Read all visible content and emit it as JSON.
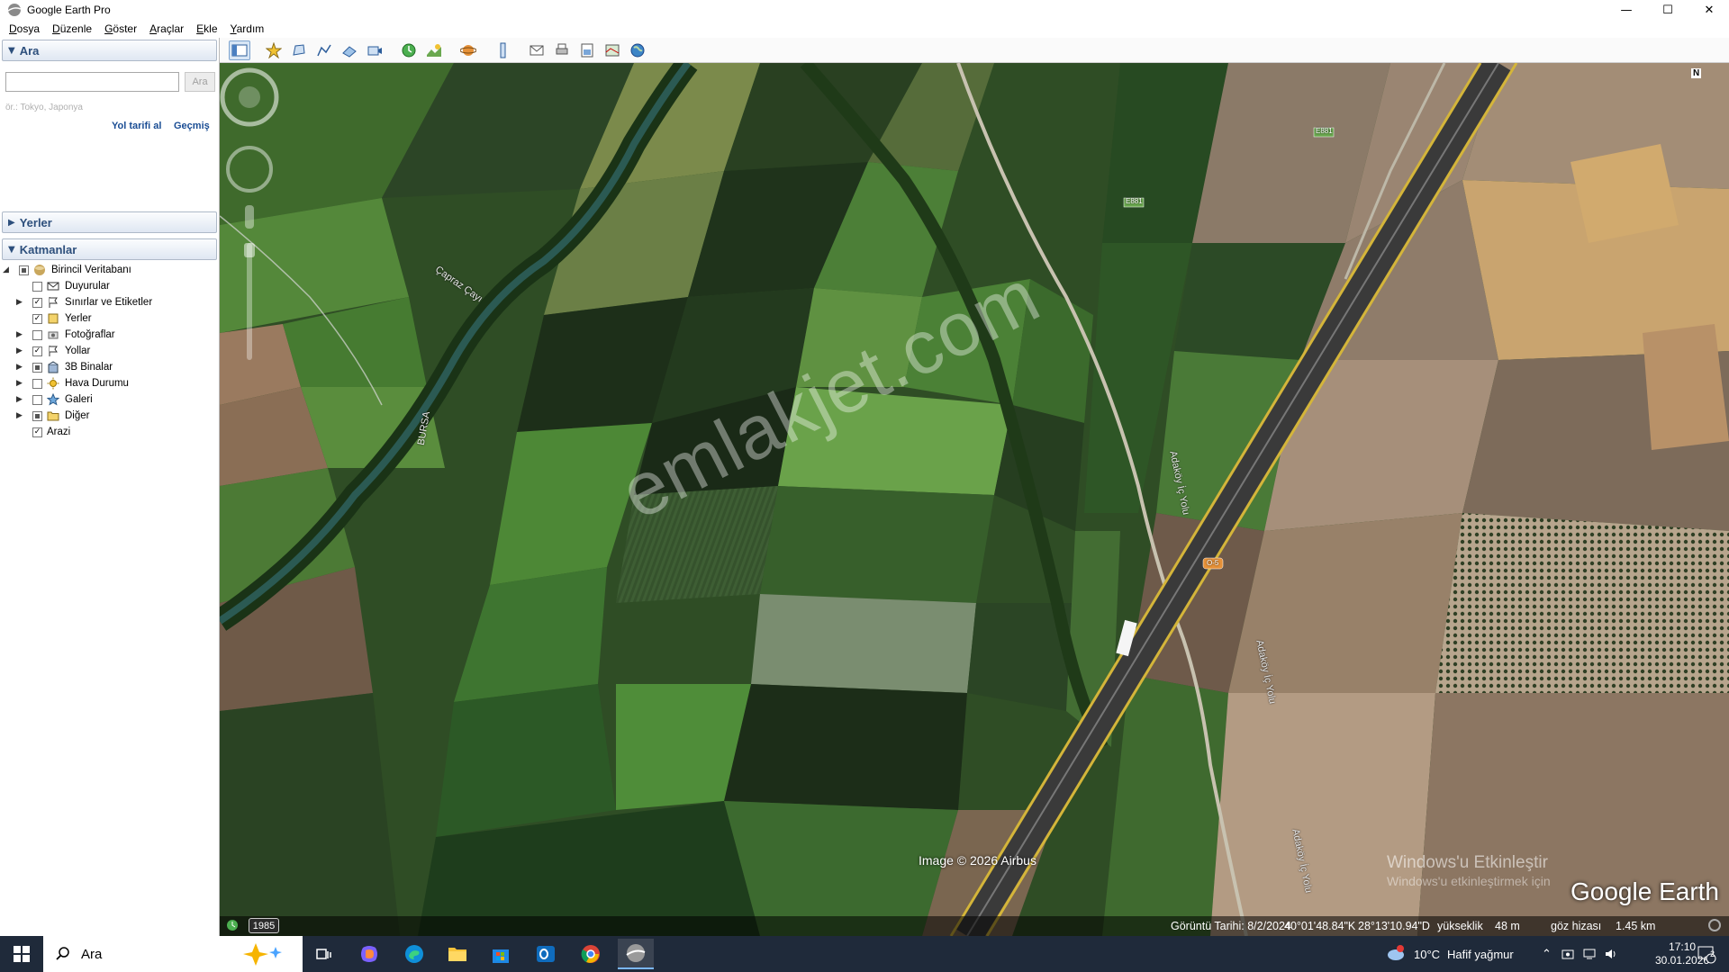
{
  "window": {
    "title": "Google Earth Pro"
  },
  "menu": [
    "Dosya",
    "Düzenle",
    "Göster",
    "Araçlar",
    "Ekle",
    "Yardım"
  ],
  "search": {
    "header": "Ara",
    "input_value": "",
    "button": "Ara",
    "hint": "ör.: Tokyo, Japonya",
    "directions_link": "Yol tarifi al",
    "history_link": "Geçmiş"
  },
  "places": {
    "header": "Yerler"
  },
  "layers": {
    "header": "Katmanlar",
    "root": "Birincil Veritabanı",
    "items": [
      {
        "label": "Duyurular",
        "checked": false
      },
      {
        "label": "Sınırlar ve Etiketler",
        "checked": true
      },
      {
        "label": "Yerler",
        "checked": true
      },
      {
        "label": "Fotoğraflar",
        "checked": false
      },
      {
        "label": "Yollar",
        "checked": true
      },
      {
        "label": "3B Binalar",
        "checked": "partial"
      },
      {
        "label": "Hava Durumu",
        "checked": false
      },
      {
        "label": "Galeri",
        "checked": false
      },
      {
        "label": "Diğer",
        "checked": "partial"
      },
      {
        "label": "Arazi",
        "checked": true
      }
    ]
  },
  "map": {
    "labels": {
      "river": "Çapraz Çayı",
      "river2": "BURSA",
      "road1": "Adaköy İç Yolu",
      "road2": "Adaköy İç Yolu",
      "road3": "Adaköy İç Yolu",
      "highway1": "E881",
      "highway2": "E881",
      "highway3": "O-5"
    },
    "watermark": "emlakjet.com",
    "copyright": "Image © 2026 Airbus",
    "logo": "Google Earth",
    "activation_title": "Windows'u Etkinleştir",
    "activation_sub": "Windows'u etkinleştirmek için",
    "history_year": "1985",
    "compass_north": "N"
  },
  "status": {
    "imagery_date": "Görüntü Tarihi: 8/2/2024",
    "lat": "40°01'48.84\"K",
    "lon": "28°13'10.94\"D",
    "elevation_label": "yükseklik",
    "elevation": "48 m",
    "eye_alt_label": "göz hizası",
    "eye_alt": "1.45 km"
  },
  "taskbar": {
    "search_placeholder": "Ara",
    "weather_temp": "10°C",
    "weather_desc": "Hafif yağmur",
    "time": "17:10",
    "date": "30.01.2026",
    "notifications": "2"
  }
}
